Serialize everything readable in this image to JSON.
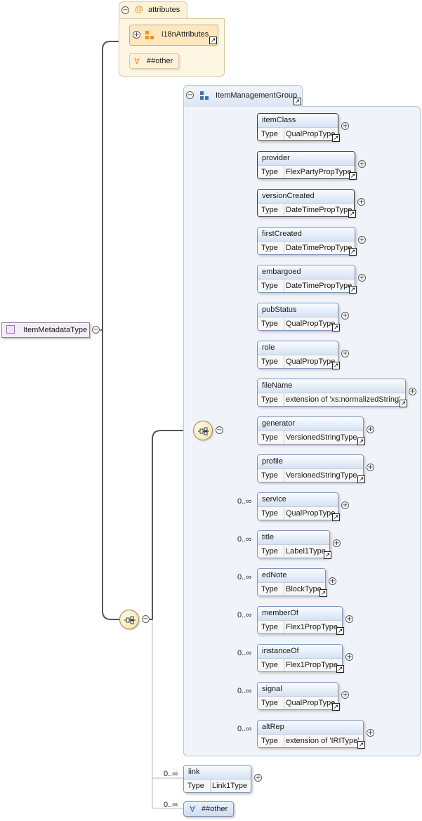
{
  "root": {
    "name": "ItemMetadataType"
  },
  "attributes": {
    "title": "attributes",
    "items": [
      {
        "name": "i18nAttributes"
      }
    ],
    "any": {
      "label": "##other"
    }
  },
  "group": {
    "name": "ItemManagementGroup"
  },
  "type_label": "Type",
  "elements": [
    {
      "name": "itemClass",
      "type": "QualPropType",
      "cardinality": "",
      "required": true
    },
    {
      "name": "provider",
      "type": "FlexPartyPropType",
      "cardinality": "",
      "required": true
    },
    {
      "name": "versionCreated",
      "type": "DateTimePropType",
      "cardinality": "",
      "required": true
    },
    {
      "name": "firstCreated",
      "type": "DateTimePropType",
      "cardinality": "",
      "required": false
    },
    {
      "name": "embargoed",
      "type": "DateTimePropType",
      "cardinality": "",
      "required": false
    },
    {
      "name": "pubStatus",
      "type": "QualPropType",
      "cardinality": "",
      "required": false
    },
    {
      "name": "role",
      "type": "QualPropType",
      "cardinality": "",
      "required": false
    },
    {
      "name": "fileName",
      "type": "extension of 'xs:normalizedString'",
      "cardinality": "",
      "required": false
    },
    {
      "name": "generator",
      "type": "VersionedStringType",
      "cardinality": "",
      "required": false
    },
    {
      "name": "profile",
      "type": "VersionedStringType",
      "cardinality": "",
      "required": false
    },
    {
      "name": "service",
      "type": "QualPropType",
      "cardinality": "0..∞",
      "required": false
    },
    {
      "name": "title",
      "type": "Label1Type",
      "cardinality": "0..∞",
      "required": false
    },
    {
      "name": "edNote",
      "type": "BlockType",
      "cardinality": "0..∞",
      "required": false
    },
    {
      "name": "memberOf",
      "type": "Flex1PropType",
      "cardinality": "0..∞",
      "required": false
    },
    {
      "name": "instanceOf",
      "type": "Flex1PropType",
      "cardinality": "0..∞",
      "required": false
    },
    {
      "name": "signal",
      "type": "QualPropType",
      "cardinality": "0..∞",
      "required": false
    },
    {
      "name": "altRep",
      "type": "extension of 'IRIType'",
      "cardinality": "0..∞",
      "required": false
    }
  ],
  "link": {
    "name": "link",
    "type": "Link1Type",
    "cardinality": "0..∞"
  },
  "any_other": {
    "label": "##other",
    "cardinality": "0..∞"
  },
  "colors": {
    "attributes_bg": "#fdf6e3",
    "group_bg": "#f0f4fa",
    "element_border": "#8096b8",
    "root_bg": "#f3eef6"
  }
}
